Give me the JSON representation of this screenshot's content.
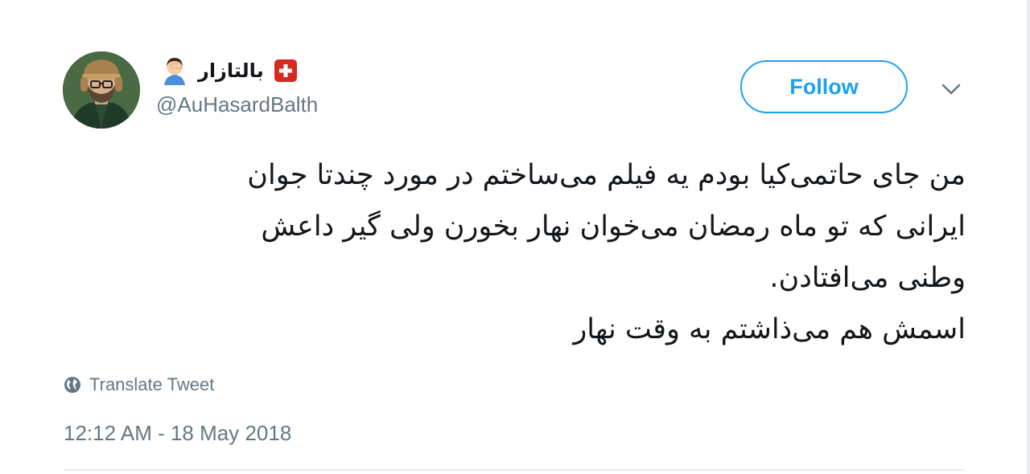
{
  "user": {
    "display_name": "بالتازار",
    "handle": "@AuHasardBalth",
    "name_emoji_icon": "face-palm-icon",
    "name_flag_icon": "swiss-flag-icon"
  },
  "actions": {
    "follow_label": "Follow",
    "more_icon": "chevron-down-icon"
  },
  "tweet": {
    "lines": [
      "من جای حاتمی‌کیا بودم یه فیلم می‌ساختم در مورد چندتا جوان",
      "ایرانی که تو ماه رمضان می‌خوان نهار بخورن ولی گیر داعش",
      "وطنی می‌افتادن.",
      "اسمش هم می‌ذاشتم به وقت نهار"
    ],
    "translate_label": "Translate Tweet",
    "translate_icon": "globe-icon",
    "timestamp": "12:12 AM - 18 May 2018"
  },
  "colors": {
    "accent": "#1da1f2",
    "text": "#14171a",
    "muted": "#657786",
    "divider": "#e6ecf0",
    "flag_red": "#d52b1e"
  }
}
